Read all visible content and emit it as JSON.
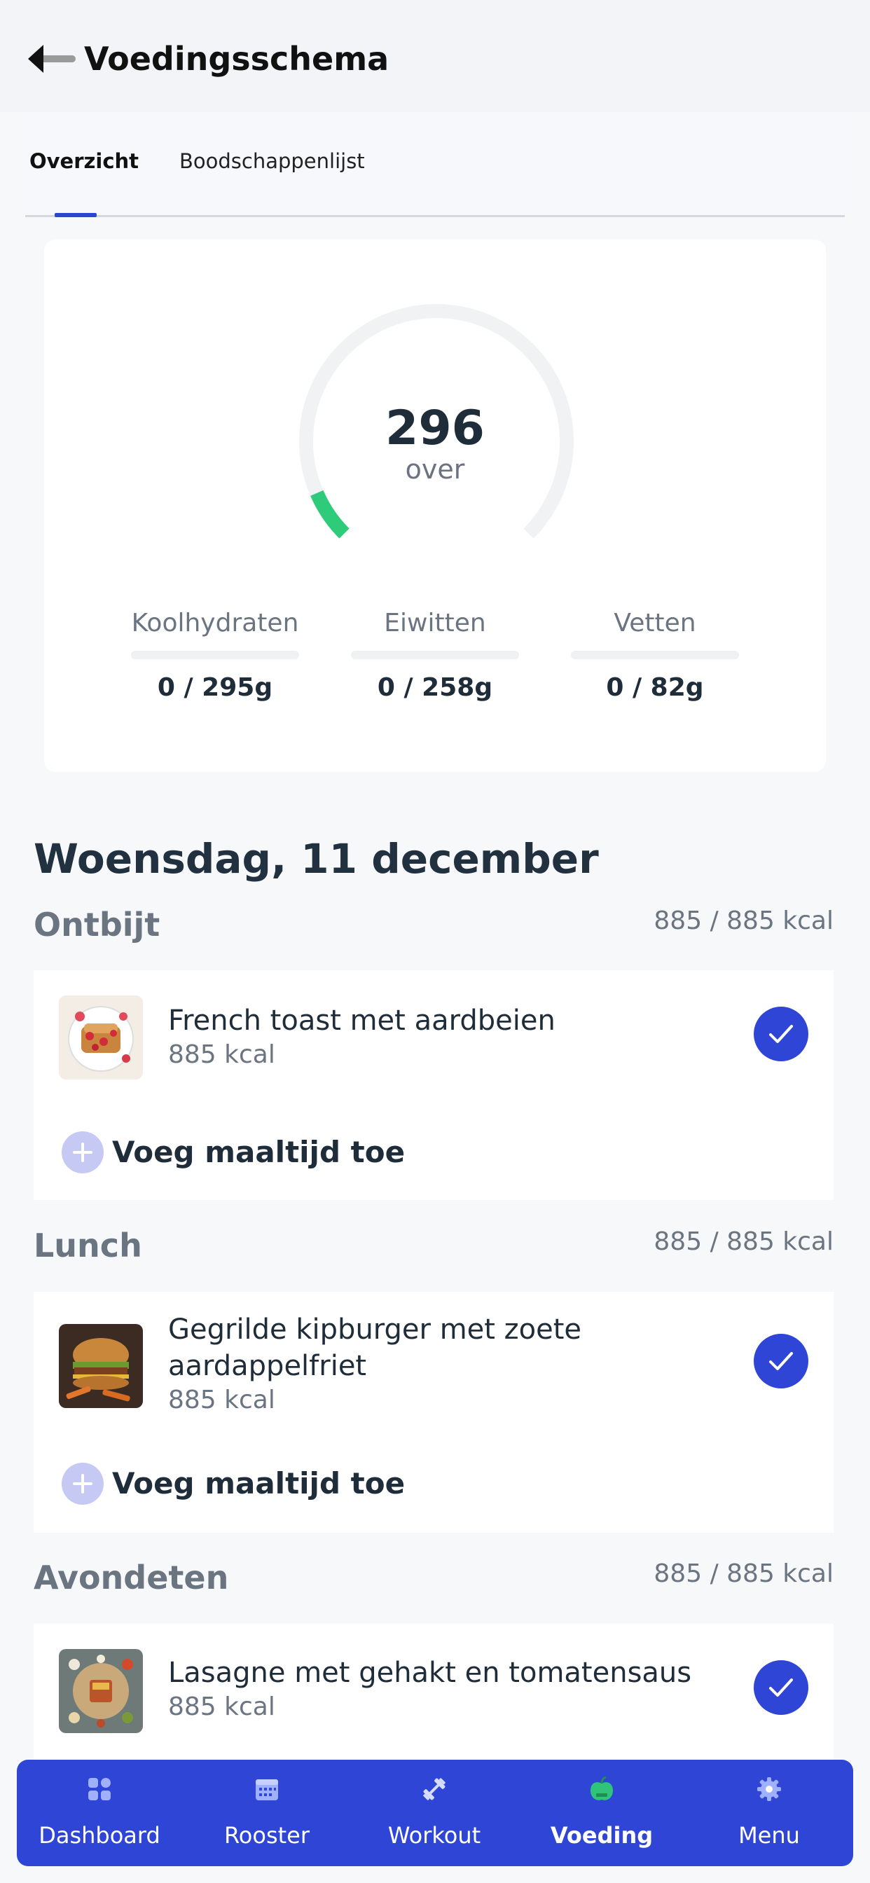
{
  "header": {
    "title": "Voedingsschema"
  },
  "tabs": [
    {
      "label": "Overzicht",
      "active": true
    },
    {
      "label": "Boodschappenlijst",
      "active": false
    }
  ],
  "summary": {
    "remaining_value": "296",
    "remaining_label": "over",
    "progress_fraction": 0.08,
    "progress_color": "#2ecc7a",
    "track_color": "#f1f2f4",
    "macros": [
      {
        "name": "Koolhydraten",
        "value": "0 / 295g"
      },
      {
        "name": "Eiwitten",
        "value": "0 / 258g"
      },
      {
        "name": "Vetten",
        "value": "0 / 82g"
      }
    ]
  },
  "date_heading": "Woensdag, 11 december",
  "meals": [
    {
      "title": "Ontbijt",
      "total": "885 / 885 kcal",
      "item_name": "French toast met aardbeien",
      "item_kcal": "885 kcal",
      "add_label": "Voeg maaltijd toe"
    },
    {
      "title": "Lunch",
      "total": "885 / 885 kcal",
      "item_name": "Gegrilde kipburger met zoete aardappelfriet",
      "item_kcal": "885 kcal",
      "add_label": "Voeg maaltijd toe"
    },
    {
      "title": "Avondeten",
      "total": "885 / 885 kcal",
      "item_name": "Lasagne met gehakt en tomatensaus",
      "item_kcal": "885 kcal"
    }
  ],
  "nav": {
    "items": [
      {
        "label": "Dashboard",
        "icon": "dashboard-icon"
      },
      {
        "label": "Rooster",
        "icon": "calendar-icon"
      },
      {
        "label": "Workout",
        "icon": "dumbbell-icon"
      },
      {
        "label": "Voeding",
        "icon": "apple-icon",
        "active": true
      },
      {
        "label": "Menu",
        "icon": "gear-icon"
      }
    ]
  },
  "colors": {
    "accent": "#2f45d6",
    "add_circle": "#c5c9f4"
  }
}
